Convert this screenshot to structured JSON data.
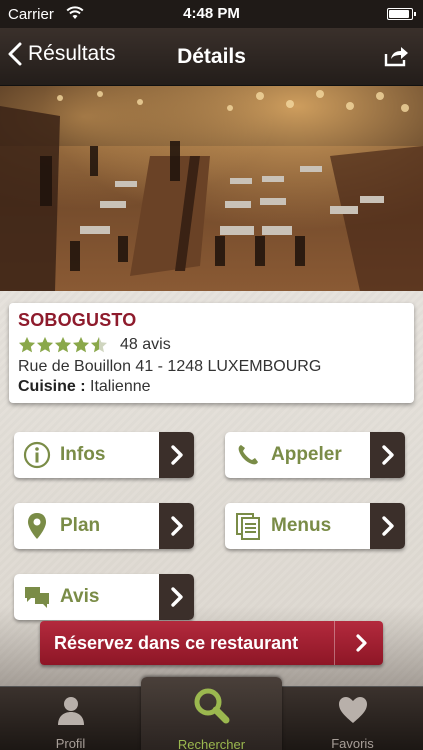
{
  "status_bar": {
    "carrier": "Carrier",
    "time": "4:48 PM",
    "battery_level": 0.95
  },
  "nav": {
    "back_label": "Résultats",
    "title": "Détails",
    "share_icon": "share-icon"
  },
  "restaurant": {
    "name": "SOBOGUSTO",
    "rating": 4.5,
    "reviews": "48 avis",
    "address": "Rue de Bouillon 41 - 1248 LUXEMBOURG",
    "cuisine_label": "Cuisine :",
    "cuisine_value": "Italienne"
  },
  "actions": {
    "infos": "Infos",
    "appeler": "Appeler",
    "plan": "Plan",
    "menus": "Menus",
    "avis": "Avis"
  },
  "reserve": {
    "label": "Réservez dans ce restaurant"
  },
  "tabs": [
    {
      "label": "Profil",
      "icon": "person-icon"
    },
    {
      "label": "Rechercher",
      "icon": "search-icon"
    },
    {
      "label": "Favoris",
      "icon": "heart-icon"
    }
  ],
  "colors": {
    "accent_green": "#7a8c47",
    "brand_red": "#8e1b2c",
    "star_green": "#8aa84a",
    "dark_brown": "#3b2f2a"
  }
}
